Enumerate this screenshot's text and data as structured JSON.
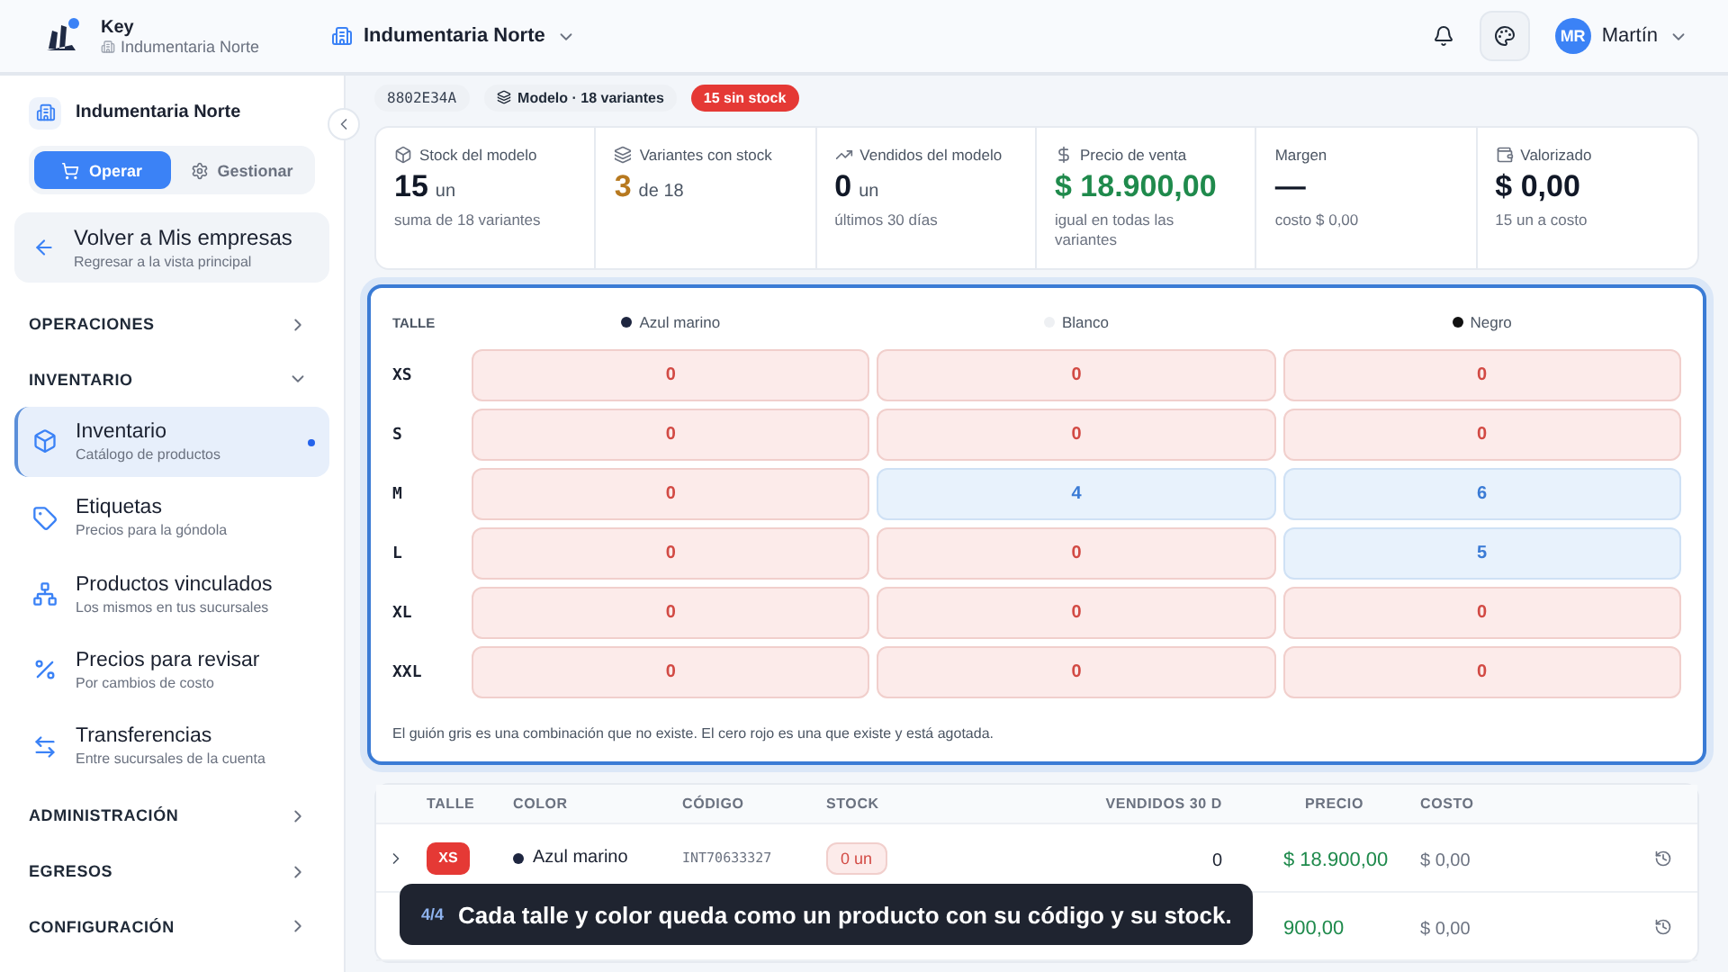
{
  "header": {
    "app_name": "Key",
    "app_company": "Indumentaria Norte",
    "company_selector": "Indumentaria Norte",
    "user_initials": "MR",
    "user_name": "Martín"
  },
  "sidebar": {
    "company": "Indumentaria Norte",
    "modes": [
      {
        "label": "Operar",
        "selected": true
      },
      {
        "label": "Gestionar",
        "selected": false
      }
    ],
    "back": {
      "title": "Volver a Mis empresas",
      "subtitle": "Regresar a la vista principal"
    },
    "sections": [
      {
        "label": "OPERACIONES",
        "expanded": false
      },
      {
        "label": "INVENTARIO",
        "expanded": true,
        "items": [
          {
            "kind": "box",
            "title": "Inventario",
            "subtitle": "Catálogo de productos",
            "selected": true
          },
          {
            "kind": "tag",
            "title": "Etiquetas",
            "subtitle": "Precios para la góndola",
            "selected": false
          },
          {
            "kind": "network",
            "title": "Productos vinculados",
            "subtitle": "Los mismos en tus sucursales",
            "selected": false
          },
          {
            "kind": "percent",
            "title": "Precios para revisar",
            "subtitle": "Por cambios de costo",
            "selected": false
          },
          {
            "kind": "transfer",
            "title": "Transferencias",
            "subtitle": "Entre sucursales de la cuenta",
            "selected": false
          }
        ]
      },
      {
        "label": "ADMINISTRACIÓN",
        "expanded": false
      },
      {
        "label": "EGRESOS",
        "expanded": false
      },
      {
        "label": "CONFIGURACIÓN",
        "expanded": false
      }
    ]
  },
  "tags": {
    "code": "8802E34A",
    "model": "Modelo · 18 variantes",
    "alert": "15 sin stock"
  },
  "stats": [
    {
      "kind": "box",
      "label": "Stock del modelo",
      "value": "15",
      "unit": "un",
      "note": "suma de 18 variantes"
    },
    {
      "kind": "layers",
      "label": "Variantes con stock",
      "value": "3",
      "unit": "de 18",
      "color": "#b7791f"
    },
    {
      "kind": "trend",
      "label": "Vendidos del modelo",
      "value": "0",
      "unit": "un",
      "note": "últimos 30 días"
    },
    {
      "kind": "dollar",
      "label": "Precio de venta",
      "value": "$ 18.900,00",
      "note": "igual en todas las variantes",
      "color": "#1f8a4c"
    },
    {
      "kind": "none",
      "label": "Margen",
      "value": "—",
      "note": "costo $ 0,00"
    },
    {
      "kind": "wallet",
      "label": "Valorizado",
      "value": "$ 0,00",
      "note": "15 un a costo"
    }
  ],
  "matrix": {
    "size_header": "TALLE",
    "colors": [
      {
        "name": "Azul marino",
        "color": "#1e2640"
      },
      {
        "name": "Blanco",
        "color": "#eef0f3"
      },
      {
        "name": "Negro",
        "color": "#111111"
      }
    ],
    "rows": [
      {
        "size": "XS",
        "cells": [
          {
            "value": "0",
            "in_stock": false
          },
          {
            "value": "0",
            "in_stock": false
          },
          {
            "value": "0",
            "in_stock": false
          }
        ]
      },
      {
        "size": "S",
        "cells": [
          {
            "value": "0",
            "in_stock": false
          },
          {
            "value": "0",
            "in_stock": false
          },
          {
            "value": "0",
            "in_stock": false
          }
        ]
      },
      {
        "size": "M",
        "cells": [
          {
            "value": "0",
            "in_stock": false
          },
          {
            "value": "4",
            "in_stock": true
          },
          {
            "value": "6",
            "in_stock": true
          }
        ]
      },
      {
        "size": "L",
        "cells": [
          {
            "value": "0",
            "in_stock": false
          },
          {
            "value": "0",
            "in_stock": false
          },
          {
            "value": "5",
            "in_stock": true
          }
        ]
      },
      {
        "size": "XL",
        "cells": [
          {
            "value": "0",
            "in_stock": false
          },
          {
            "value": "0",
            "in_stock": false
          },
          {
            "value": "0",
            "in_stock": false
          }
        ]
      },
      {
        "size": "XXL",
        "cells": [
          {
            "value": "0",
            "in_stock": false
          },
          {
            "value": "0",
            "in_stock": false
          },
          {
            "value": "0",
            "in_stock": false
          }
        ]
      }
    ],
    "legend": "El guión gris es una combinación que no existe. El cero rojo es una que existe y está agotada."
  },
  "table": {
    "columns": [
      "TALLE",
      "COLOR",
      "CÓDIGO",
      "STOCK",
      "VENDIDOS 30 D",
      "PRECIO",
      "COSTO"
    ],
    "rows": [
      {
        "size": "XS",
        "color_name": "Azul marino",
        "color": "#1e2640",
        "code": "INT70633327",
        "stock": "0 un",
        "sold": "0",
        "price": "$ 18.900,00",
        "cost": "$ 0,00"
      },
      {
        "price": "900,00",
        "cost": "$ 0,00"
      }
    ]
  },
  "tooltip": {
    "step": "4/4",
    "text": "Cada talle y color queda como un producto con su código y su stock."
  }
}
